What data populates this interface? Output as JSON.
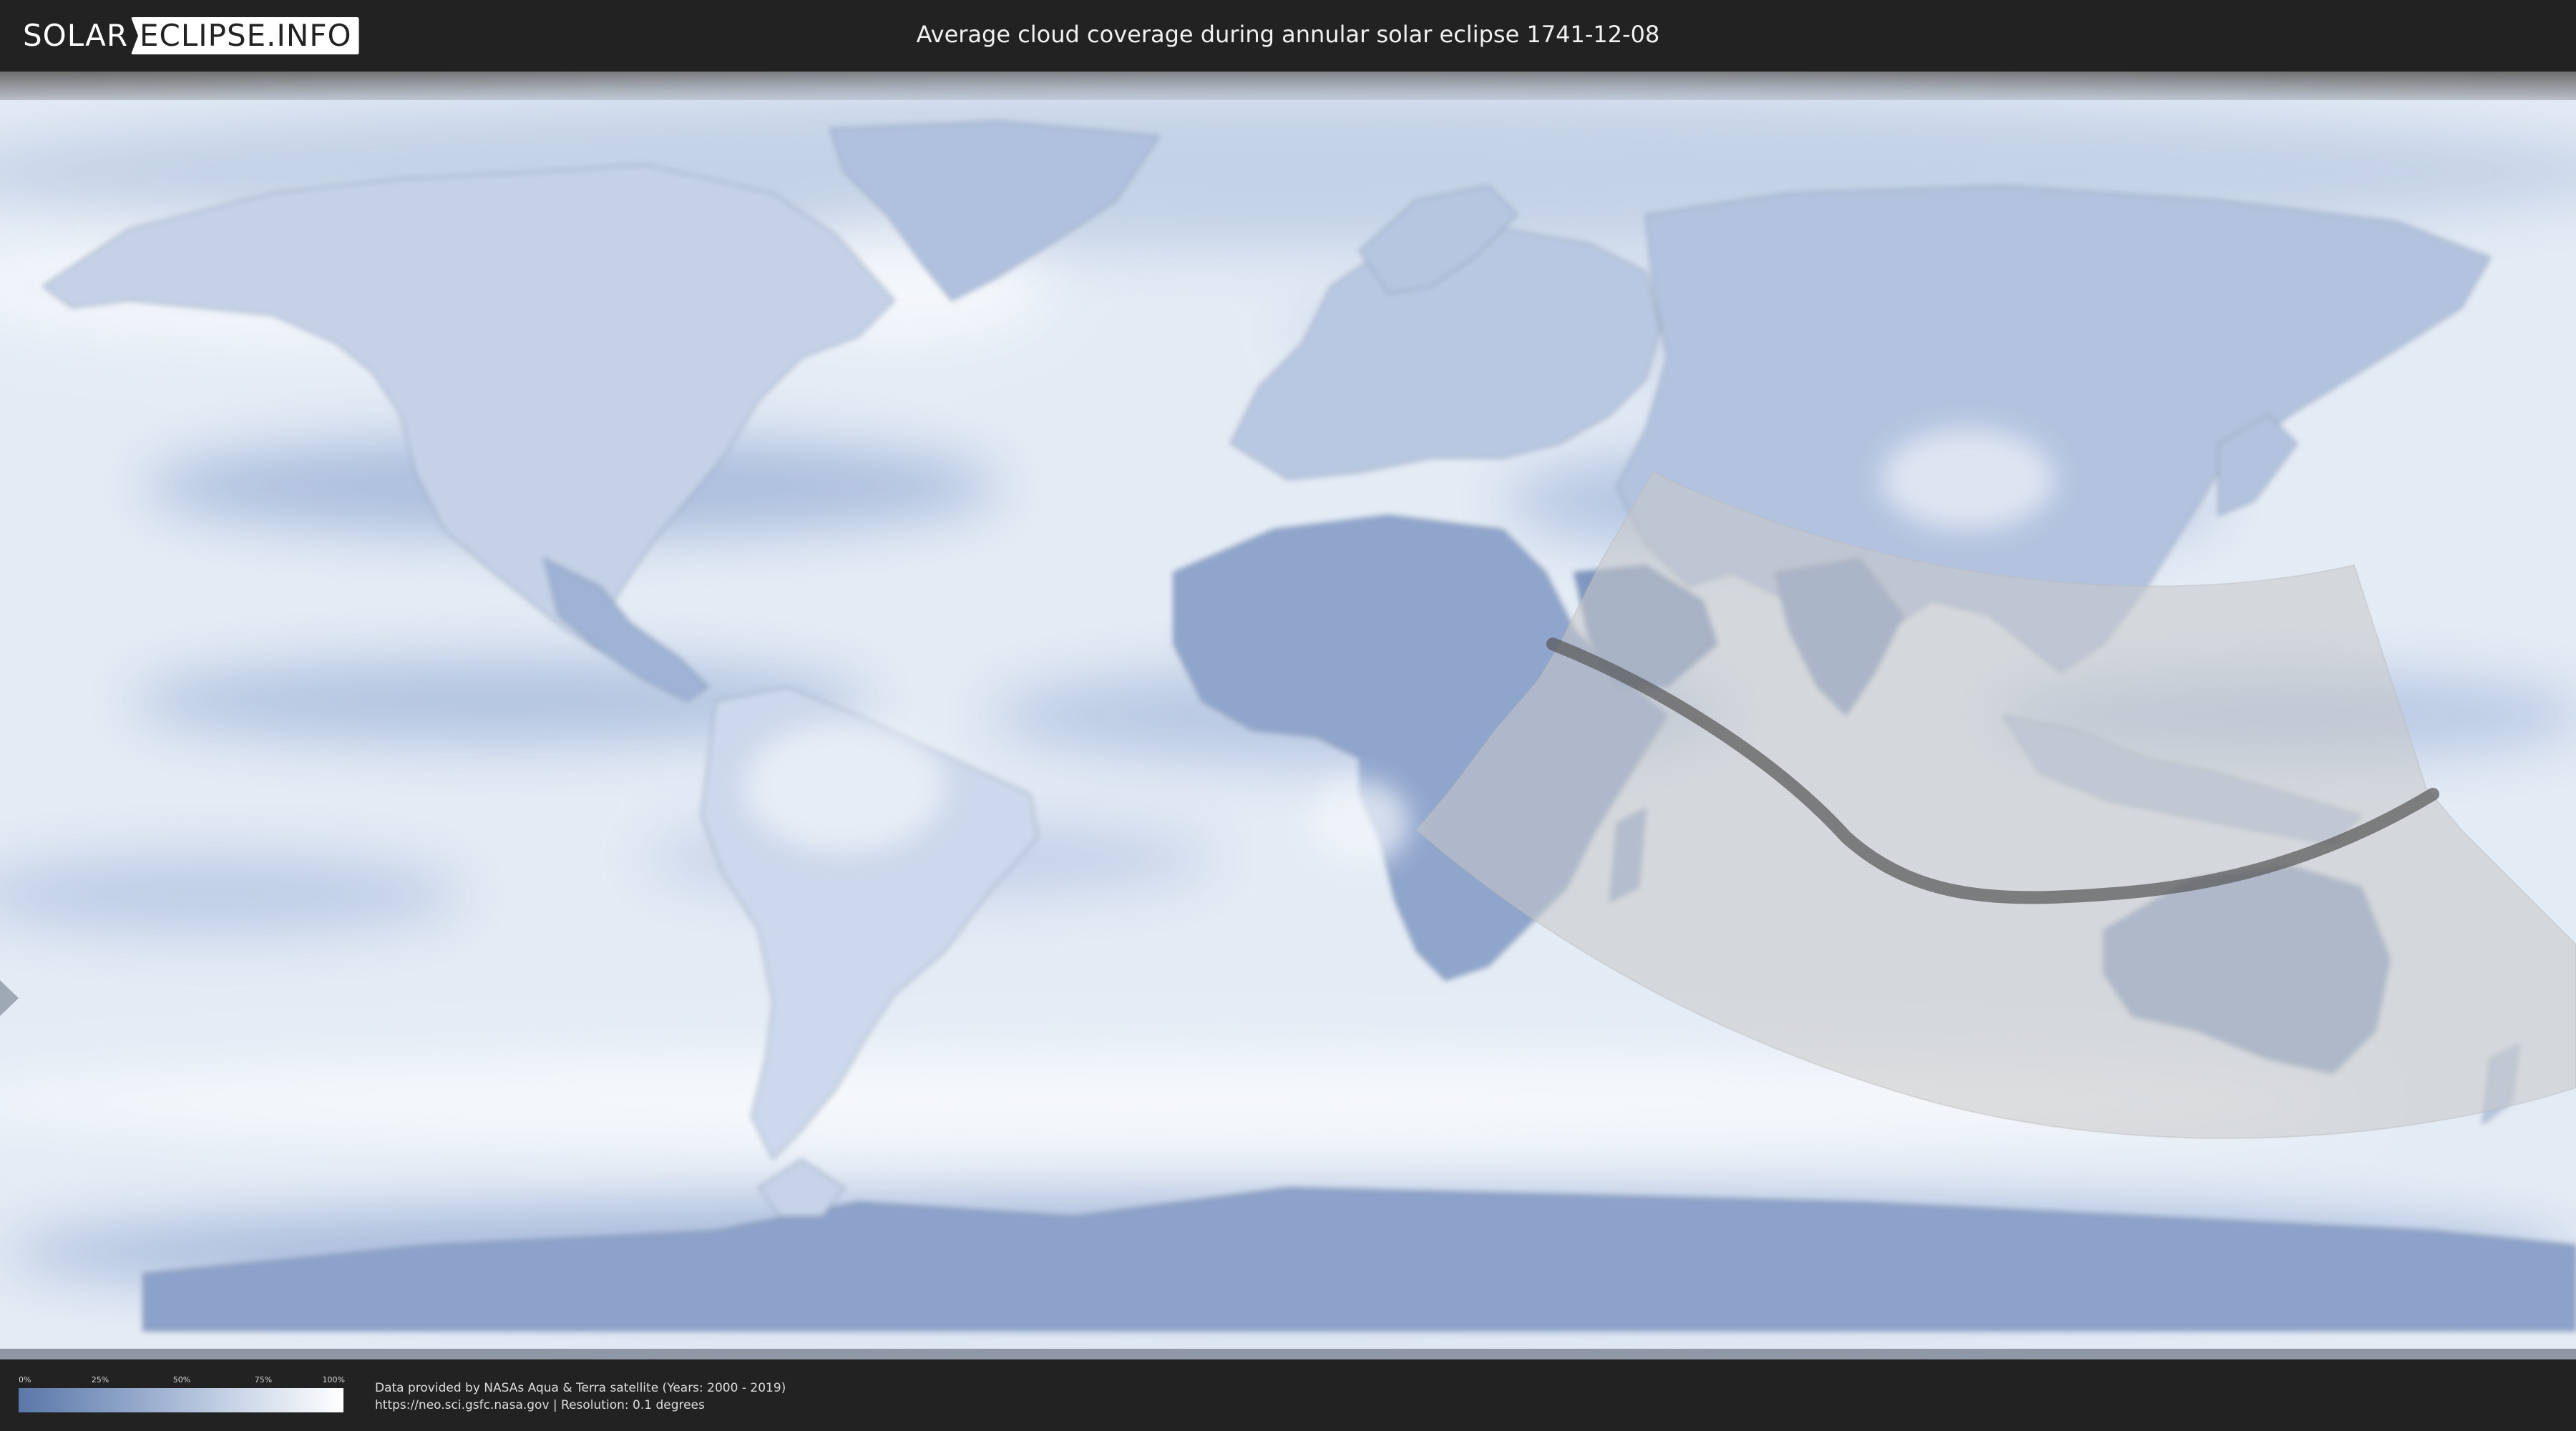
{
  "header": {
    "logo": {
      "part1": "SOLAR",
      "part2": "ECLIPSE.INFO"
    },
    "title": "Average cloud coverage during annular solar eclipse 1741-12-08"
  },
  "legend": {
    "ticks": [
      "0%",
      "25%",
      "50%",
      "75%",
      "100%"
    ],
    "gradient_colors": [
      "#5a77a8",
      "#8ea4c8",
      "#c9d5e7",
      "#ffffff"
    ]
  },
  "credits": {
    "line1": "Data provided by NASAs Aqua & Terra satellite (Years: 2000 - 2019)",
    "line2": "https://neo.sci.gsfc.nasa.gov | Resolution: 0.1 degrees"
  },
  "map": {
    "projection": "equirectangular",
    "ocean_color": "#dfe8f3",
    "cloud_light_color": "#f4f7fb",
    "cloud_dark_color": "#7b93bd",
    "eclipse_zone_color": "#c8c8c8",
    "eclipse_path_color": "#555555"
  }
}
